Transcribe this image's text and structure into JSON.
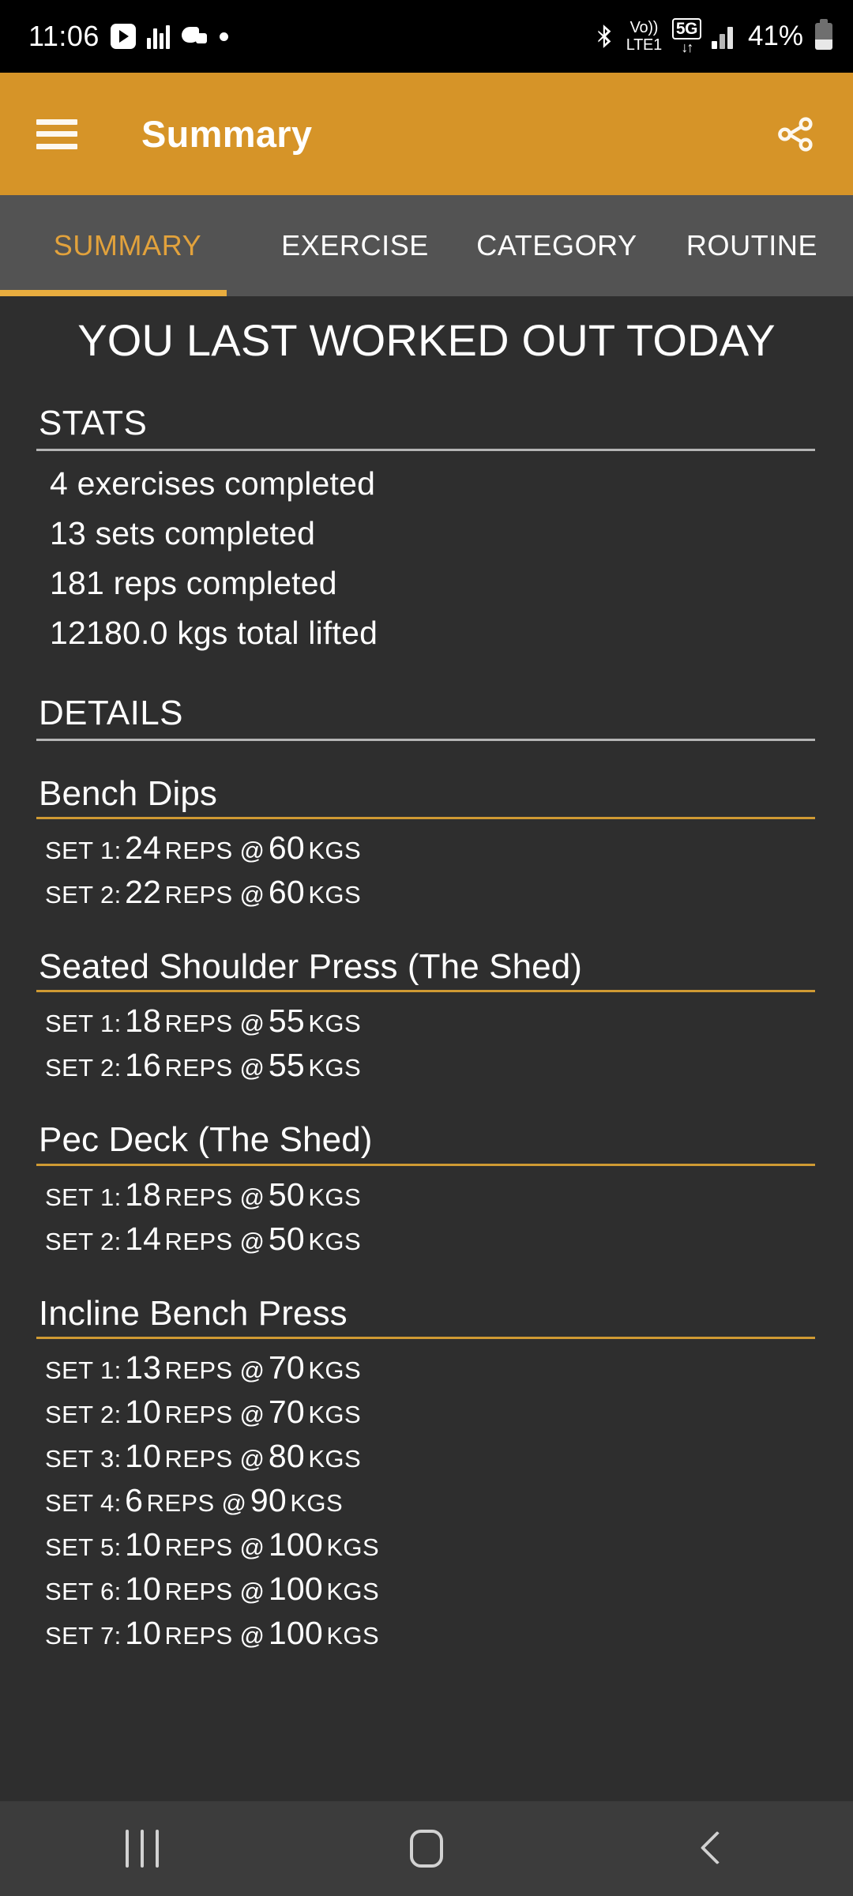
{
  "status_bar": {
    "time": "11:06",
    "left_icons": [
      "youtube-icon",
      "equalizer-icon",
      "game-blob-icon",
      "dot-icon"
    ],
    "bluetooth_icon": "bluetooth-icon",
    "volte_top": "Vo))",
    "volte_bottom": "LTE1",
    "network_badge": "5G",
    "data_arrows": "↓↑",
    "signal_icon": "signal-bars-icon",
    "battery_percent": "41%"
  },
  "app_bar": {
    "menu_icon": "hamburger-menu-icon",
    "title": "Summary",
    "share_icon": "share-icon"
  },
  "tabs": {
    "items": [
      {
        "label": "SUMMARY",
        "active": true
      },
      {
        "label": "EXERCISE",
        "active": false
      },
      {
        "label": "CATEGORY",
        "active": false
      },
      {
        "label": "ROUTINE",
        "active": false
      }
    ]
  },
  "main": {
    "headline": "YOU LAST WORKED OUT TODAY",
    "stats": {
      "title": "STATS",
      "lines": [
        "4 exercises completed",
        "13 sets completed",
        "181 reps completed",
        "12180.0 kgs total lifted"
      ]
    },
    "details": {
      "title": "DETAILS",
      "exercises": [
        {
          "name": "Bench Dips",
          "sets": [
            {
              "label": "SET 1:",
              "reps": "24",
              "reps_unit": "REPS @",
              "weight": "60",
              "weight_unit": "KGS"
            },
            {
              "label": "SET 2:",
              "reps": "22",
              "reps_unit": "REPS @",
              "weight": "60",
              "weight_unit": "KGS"
            }
          ]
        },
        {
          "name": "Seated Shoulder Press (The Shed)",
          "sets": [
            {
              "label": "SET 1:",
              "reps": "18",
              "reps_unit": "REPS @",
              "weight": "55",
              "weight_unit": "KGS"
            },
            {
              "label": "SET 2:",
              "reps": "16",
              "reps_unit": "REPS @",
              "weight": "55",
              "weight_unit": "KGS"
            }
          ]
        },
        {
          "name": "Pec Deck (The Shed)",
          "sets": [
            {
              "label": "SET 1:",
              "reps": "18",
              "reps_unit": "REPS @",
              "weight": "50",
              "weight_unit": "KGS"
            },
            {
              "label": "SET 2:",
              "reps": "14",
              "reps_unit": "REPS @",
              "weight": "50",
              "weight_unit": "KGS"
            }
          ]
        },
        {
          "name": "Incline Bench Press",
          "sets": [
            {
              "label": "SET 1:",
              "reps": "13",
              "reps_unit": "REPS @",
              "weight": "70",
              "weight_unit": "KGS"
            },
            {
              "label": "SET 2:",
              "reps": "10",
              "reps_unit": "REPS @",
              "weight": "70",
              "weight_unit": "KGS"
            },
            {
              "label": "SET 3:",
              "reps": "10",
              "reps_unit": "REPS @",
              "weight": "80",
              "weight_unit": "KGS"
            },
            {
              "label": "SET 4:",
              "reps": "6",
              "reps_unit": "REPS @",
              "weight": "90",
              "weight_unit": "KGS"
            },
            {
              "label": "SET 5:",
              "reps": "10",
              "reps_unit": "REPS @",
              "weight": "100",
              "weight_unit": "KGS"
            },
            {
              "label": "SET 6:",
              "reps": "10",
              "reps_unit": "REPS @",
              "weight": "100",
              "weight_unit": "KGS"
            },
            {
              "label": "SET 7:",
              "reps": "10",
              "reps_unit": "REPS @",
              "weight": "100",
              "weight_unit": "KGS"
            }
          ]
        }
      ]
    }
  },
  "nav_bar": {
    "recents_icon": "recents-icon",
    "home_icon": "home-icon",
    "back_icon": "back-icon"
  },
  "colors": {
    "accent": "#d69428",
    "tab_active": "#e2a23c",
    "exercise_rule": "#cf9a33",
    "background": "#2e2e2e",
    "tabbar": "#535353",
    "navbar": "#3c3c3c"
  }
}
